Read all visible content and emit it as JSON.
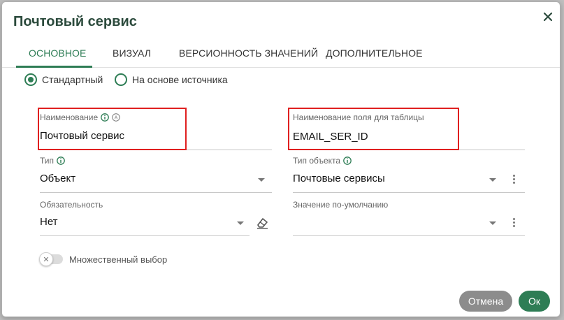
{
  "dialog": {
    "title": "Почтовый сервис",
    "close_icon": "close-icon"
  },
  "tabs": [
    {
      "label": "ОСНОВНОЕ",
      "active": true
    },
    {
      "label": "ВИЗУАЛ",
      "active": false
    },
    {
      "label": "ВЕРСИОННОСТЬ ЗНАЧЕНИЙ",
      "active": false
    },
    {
      "label": "ДОПОЛНИТЕЛЬНОЕ",
      "active": false
    }
  ],
  "source_mode": {
    "options": [
      {
        "label": "Стандартный",
        "selected": true
      },
      {
        "label": "На основе источника",
        "selected": false
      }
    ]
  },
  "fields": {
    "name": {
      "label": "Наименование",
      "value": "Почтовый сервис"
    },
    "table_field_name": {
      "label": "Наименование поля для таблицы",
      "value": "EMAIL_SER_ID"
    },
    "type": {
      "label": "Тип",
      "value": "Объект"
    },
    "object_type": {
      "label": "Тип объекта",
      "value": "Почтовые сервисы"
    },
    "required": {
      "label": "Обязательность",
      "value": "Нет"
    },
    "default_value": {
      "label": "Значение по-умолчанию",
      "value": ""
    }
  },
  "multiple_choice": {
    "label": "Множественный выбор",
    "enabled": false,
    "knob_glyph": "✕"
  },
  "buttons": {
    "cancel": "Отмена",
    "ok": "Ок"
  },
  "colors": {
    "accent": "#2e7d55",
    "highlight": "#e02020",
    "cancel_bg": "#8c8c8c"
  }
}
